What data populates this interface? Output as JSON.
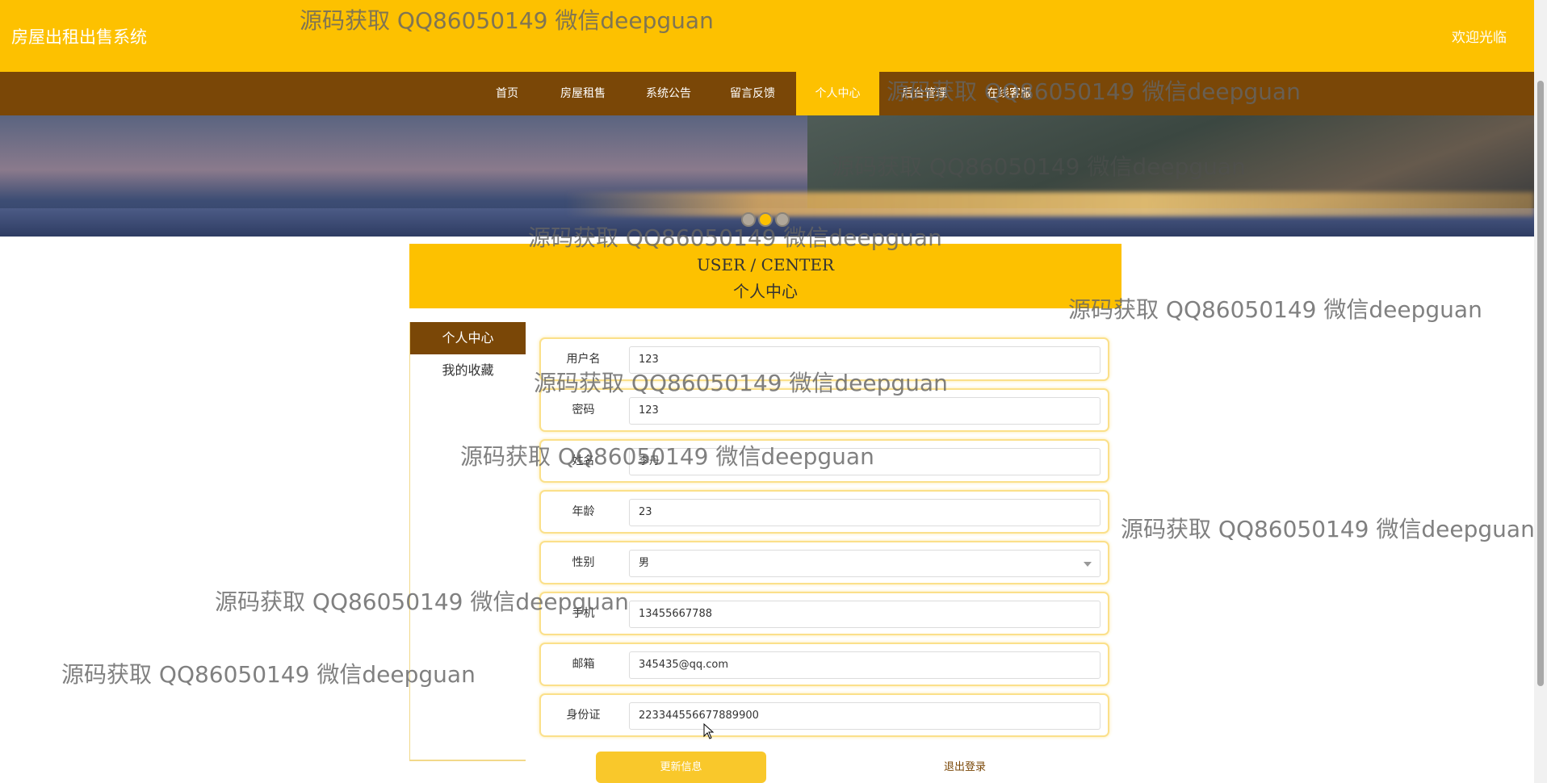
{
  "header": {
    "brand": "房屋出租出售系统",
    "welcome": "欢迎光临"
  },
  "nav": {
    "items": [
      "首页",
      "房屋租售",
      "系统公告",
      "留言反馈",
      "个人中心",
      "后台管理",
      "在线客服"
    ],
    "active": "个人中心"
  },
  "banner": {
    "slides": 3,
    "active_slide": 2
  },
  "hero": {
    "title_en": "USER / CENTER",
    "title_cn": "个人中心"
  },
  "sidebar": {
    "items": [
      "个人中心",
      "我的收藏"
    ],
    "active": "个人中心"
  },
  "form": {
    "fields": [
      {
        "label": "用户名",
        "value": "123"
      },
      {
        "label": "密码",
        "value": "123"
      },
      {
        "label": "姓名",
        "value": "李丹"
      },
      {
        "label": "年龄",
        "value": "23"
      },
      {
        "label": "性别",
        "value": "男"
      },
      {
        "label": "手机",
        "value": "13455667788"
      },
      {
        "label": "邮箱",
        "value": "345435@qq.com"
      },
      {
        "label": "身份证",
        "value": "223344556677889900"
      }
    ],
    "update_label": "更新信息",
    "logout_label": "退出登录"
  },
  "watermark": "源码获取 QQ86050149 微信deepguan",
  "colors": {
    "primary": "#fdc100",
    "nav": "#7a4707"
  }
}
